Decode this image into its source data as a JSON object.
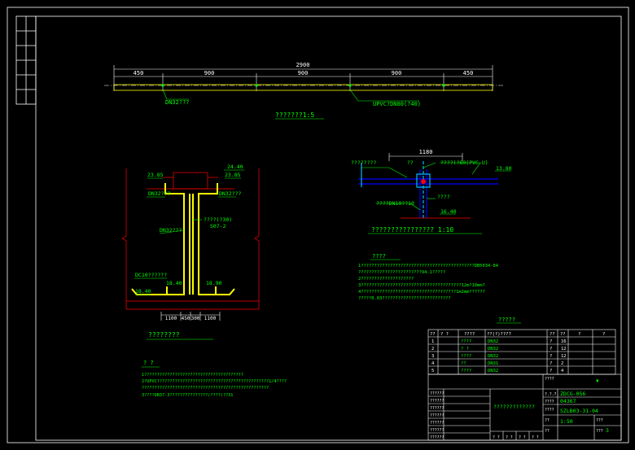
{
  "top_elevation": {
    "overall_dim": "2900",
    "segment_dims": [
      "450",
      "900",
      "900",
      "900",
      "450"
    ],
    "label_left": "DN32???",
    "label_right": "UPVC?DN80(?40)",
    "caption": "???????1:5"
  },
  "section": {
    "el_top": "24.40",
    "el_left_top": "23.85",
    "el_right_top": "23.85",
    "label_left_pipe": "DN32???",
    "label_right_pipe": "DN32???",
    "label_center": "????(?30)",
    "label_center_sub": "S07-2",
    "label_riser": "DN32???",
    "label_bottom_left": "DC10??????",
    "el_bottom_left": "18.40",
    "el_bottom_mid": "18.40",
    "el_bottom_right": "18.90",
    "dims_bottom": [
      "1100",
      "450",
      "300",
      "1100"
    ],
    "caption": "????????"
  },
  "detail": {
    "top_dim": "1180",
    "label_left": "????????",
    "label_center": "??",
    "label_right": "????(?80(PVC-U)",
    "el_right": "13.80",
    "label_mid": "????",
    "label_bottom_left": "????DN10??10",
    "el_bottom": "16.40",
    "caption": "???????????????? 1:10"
  },
  "notes": {
    "title": "????",
    "lines": [
      "1???????????????????????????????????????????DB5034-84",
      "  ????????????????????????94.1?????",
      "2????????????????????",
      "3??????????????????????????????????????12m?10mm?",
      "4????????????????????????????????????1m2mm??????",
      "  ?????0.03??????????????????????????"
    ]
  },
  "notes2": {
    "title": "?  ?",
    "lines": [
      "1???????????????????????????????????????",
      "2?UPVC????????????????????????????????????????????1/4????",
      "  ??????????????????????????????????????????????????",
      "3????DB37-3???????????????(????)??31"
    ]
  },
  "table": {
    "title": "?????",
    "headers": [
      "??",
      "?  ?",
      "????",
      "??(?)????",
      "??",
      "??",
      "?",
      "?"
    ],
    "rows": [
      [
        "1",
        "????",
        "DN32",
        "?",
        "16"
      ],
      [
        "2",
        "?  ?",
        "DN32",
        "?",
        "12"
      ],
      [
        "3",
        "????",
        "DN32",
        "?",
        "12"
      ],
      [
        "4",
        "??",
        "DN31",
        "?",
        "2"
      ],
      [
        "5",
        "????",
        "DN32",
        "?",
        "4"
      ]
    ]
  },
  "title_block": {
    "project": "????",
    "project_sub": "",
    "code_label_1": "?.?.?.",
    "code_value_1": "ZDCG-056",
    "code_label_2": "????",
    "code_value_2": "04367",
    "drawing_title": "?????????????",
    "drawing_no_label": "????",
    "drawing_no": "SZLB03-31-04",
    "scale_label": "??",
    "scale": "1:50",
    "date_label": "??",
    "sheet_label": "???",
    "sheet": "3",
    "version": "???",
    "left_rows": [
      "??????",
      "??????",
      "??????",
      "??????",
      "??????",
      "??????",
      "??????"
    ],
    "bottom_cells": [
      "?  ?",
      "?  ?",
      "?  ?",
      "?  ?"
    ]
  },
  "colors": {
    "background": "#000000",
    "frame": "#ffffff",
    "dimension": "#ffffff",
    "annotation": "#00ff00",
    "section_outline": "#ff0000",
    "pipe": "#ffff00",
    "detail_line": "#0000ff",
    "detail_highlight": "#00bfff"
  }
}
